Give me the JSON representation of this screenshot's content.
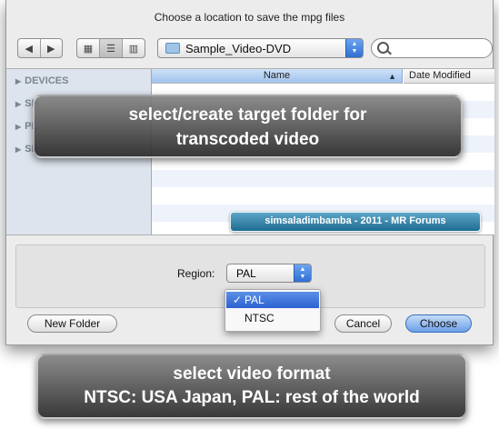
{
  "dialog": {
    "title": "Choose a location to save the mpg files",
    "nav_back_icon": "triangle-left-icon",
    "nav_forward_icon": "triangle-right-icon",
    "view_modes": [
      "icon-view",
      "list-view",
      "column-view"
    ],
    "active_view": "list-view",
    "folder": "Sample_Video-DVD",
    "search": {
      "value": "",
      "placeholder": ""
    }
  },
  "sidebar": {
    "sections": [
      "DEVICES",
      "SH",
      "PL",
      "SE"
    ]
  },
  "file_list": {
    "columns": [
      "Name",
      "Date Modified"
    ],
    "sort_indicator": "▲"
  },
  "region": {
    "label": "Region:",
    "selected": "PAL",
    "options": [
      "PAL",
      "NTSC"
    ],
    "checkmark": "✓"
  },
  "buttons": {
    "new_folder": "New Folder",
    "cancel": "Cancel",
    "choose": "Choose"
  },
  "annotations": {
    "top_line1": "select/create target folder for",
    "top_line2": "transcoded video",
    "bottom_line1": "select video format",
    "bottom_line2": "NTSC: USA  Japan, PAL: rest of the world",
    "watermark": "simsaladimbamba - 2011 - MR Forums"
  },
  "colors": {
    "accent_blue": "#3a7be0",
    "sidebar_bg": "#dde4ed",
    "window_bg": "#ececec"
  }
}
